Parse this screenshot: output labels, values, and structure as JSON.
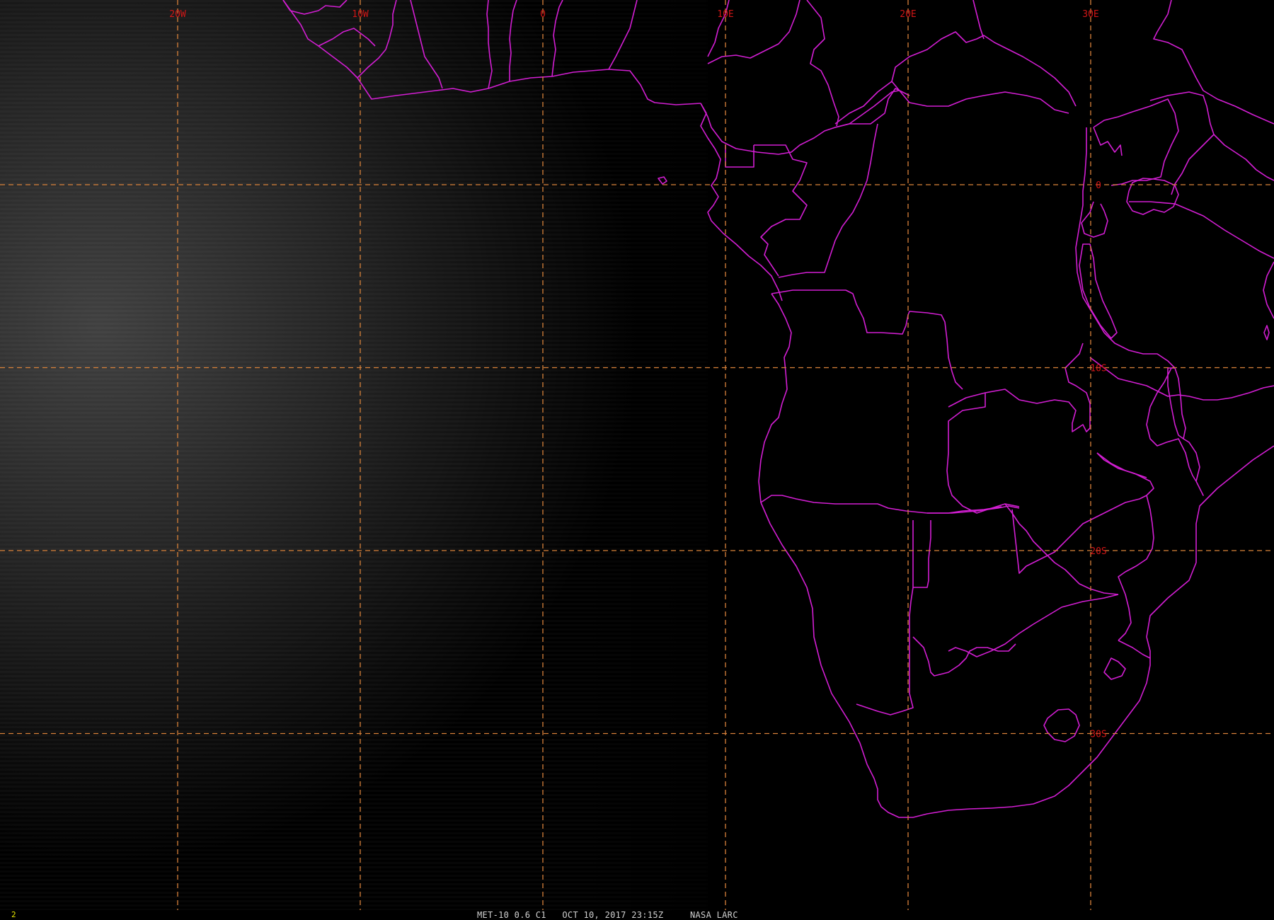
{
  "image": {
    "product": "MET-10 0.6 C1",
    "datetime": "OCT 10, 2017 23:15Z",
    "source": "NASA LARC",
    "frame_number": "2"
  },
  "grid": {
    "longitudes": [
      {
        "value": -20,
        "label": "20W"
      },
      {
        "value": -10,
        "label": "10W"
      },
      {
        "value": 0,
        "label": "0"
      },
      {
        "value": 10,
        "label": "10E"
      },
      {
        "value": 20,
        "label": "20E"
      },
      {
        "value": 30,
        "label": "30E"
      }
    ],
    "latitudes": [
      {
        "value": 0,
        "label": "0"
      },
      {
        "value": -10,
        "label": "10S"
      },
      {
        "value": -20,
        "label": "20S"
      },
      {
        "value": -30,
        "label": "30S"
      }
    ]
  },
  "colors": {
    "background": "#000000",
    "grid": "#d9823a",
    "grid_labels": "#d11616",
    "political_borders": "#d21ed2",
    "caption_text": "#d0d0d0",
    "frame_number": "#e6e600"
  }
}
